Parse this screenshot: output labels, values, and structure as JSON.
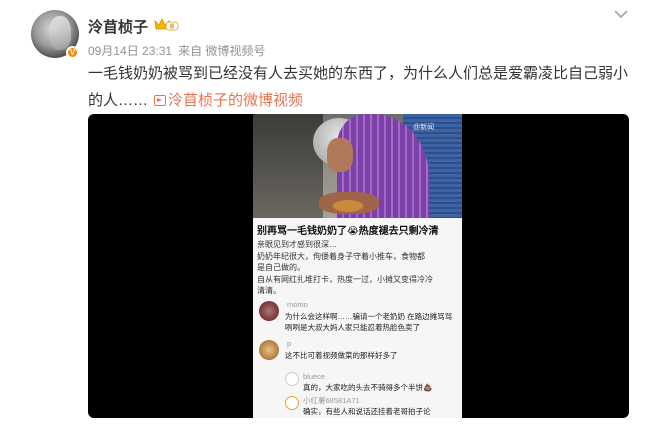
{
  "post": {
    "username": "泠苜桢子",
    "vip_badge": "II",
    "date": "09月14日 23:31",
    "source": "来自 微博视频号",
    "text": "一毛钱奶奶被骂到已经没有人去买她的东西了，为什么人们总是爱霸凌比自己弱小的人……",
    "link_text": "泠苜桢子的微博视频"
  },
  "video": {
    "watermark": "@新闻",
    "frame_title": "别再骂一毛钱奶奶了😭热度褪去只剩冷清",
    "frame_body": [
      "亲眼见到才感到很深…",
      "奶奶年纪很大，佝偻着身子守着小推车，食物都",
      "是自己做的。",
      "自从有网红扎堆打卡，热度一过，小摊又变得冷冷",
      "清清。"
    ],
    "comments": [
      {
        "name": "momo",
        "text": "为什么会这样啊……骗请一个老奶奶 在路边摊骂骂咧咧是大叔大妈人家只能忍着热脸色卖了"
      },
      {
        "name": "p",
        "text": "这不比可着视频做菜的那样好多了"
      }
    ],
    "replies": [
      {
        "name": "bluece",
        "text": "真的，大家吃的头去不骑得多个半饼💩"
      },
      {
        "name": "小红薯68581A71",
        "text": "确实，有些人和说话还挂着老哥拍子论"
      }
    ]
  },
  "colors": {
    "accent": "#eb7350",
    "vip": "#f7b500",
    "meta": "#939393"
  },
  "icons": {
    "more": "chevron-down-icon",
    "vip": "crown-icon",
    "link": "video-link-icon"
  }
}
